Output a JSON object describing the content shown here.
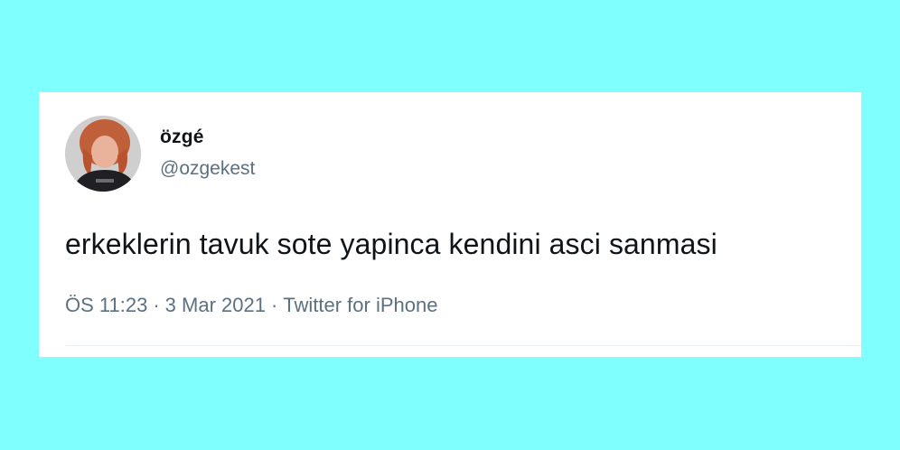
{
  "tweet": {
    "author": {
      "display_name": "özgé",
      "handle": "@ozgekest",
      "avatar_icon": "profile-photo"
    },
    "text": "erkeklerin tavuk sote yapinca kendini asci sanmasi",
    "meta": {
      "time": "ÖS 11:23",
      "separator": "·",
      "date": "3 Mar 2021",
      "source": "Twitter for iPhone"
    }
  },
  "colors": {
    "page_background": "#80ffff",
    "card_background": "#ffffff",
    "primary_text": "#0f1419",
    "secondary_text": "#5b7083",
    "divider": "#e6ecf0"
  }
}
